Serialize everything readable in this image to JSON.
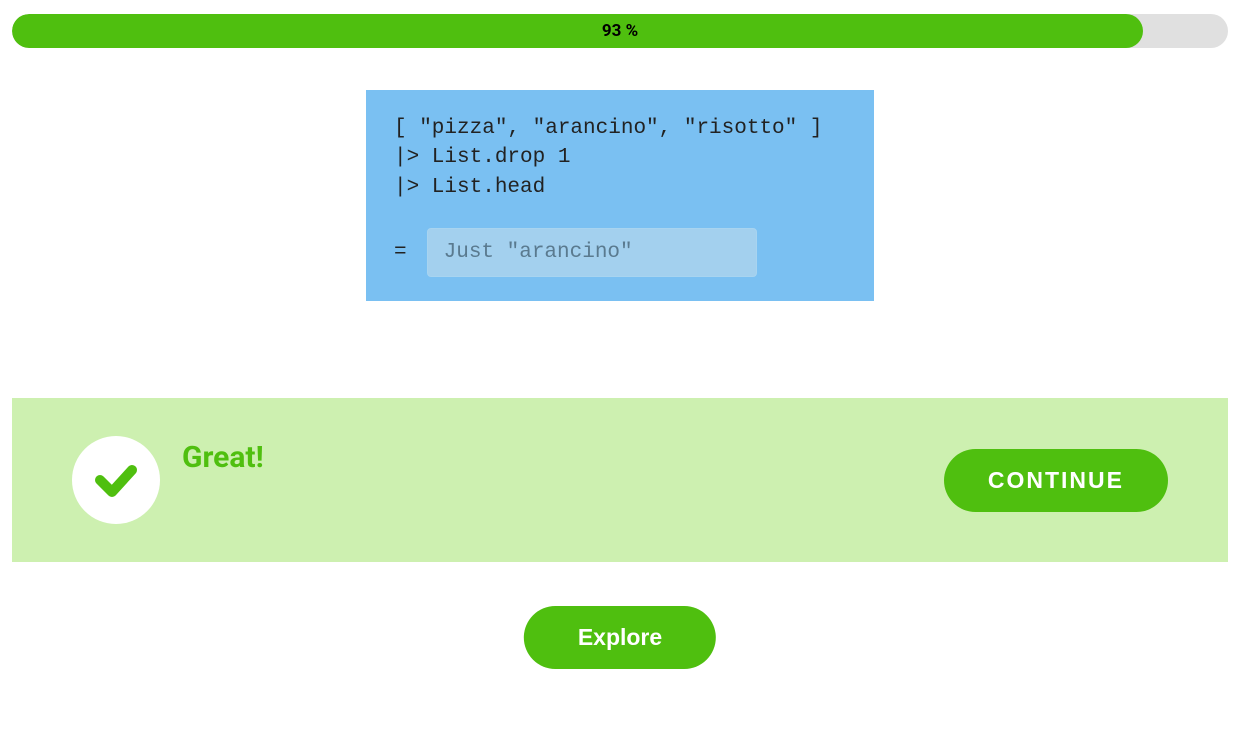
{
  "progress": {
    "percent": 93,
    "label": "93 %"
  },
  "code": {
    "line1": "[ \"pizza\", \"arancino\", \"risotto\" ]",
    "line2": "|> List.drop 1",
    "line3": "|> List.head",
    "equals": "=",
    "answer_placeholder": "Just \"arancino\"",
    "answer_value": ""
  },
  "feedback": {
    "message": "Great!",
    "continue_label": "CONTINUE"
  },
  "explore": {
    "label": "Explore"
  }
}
